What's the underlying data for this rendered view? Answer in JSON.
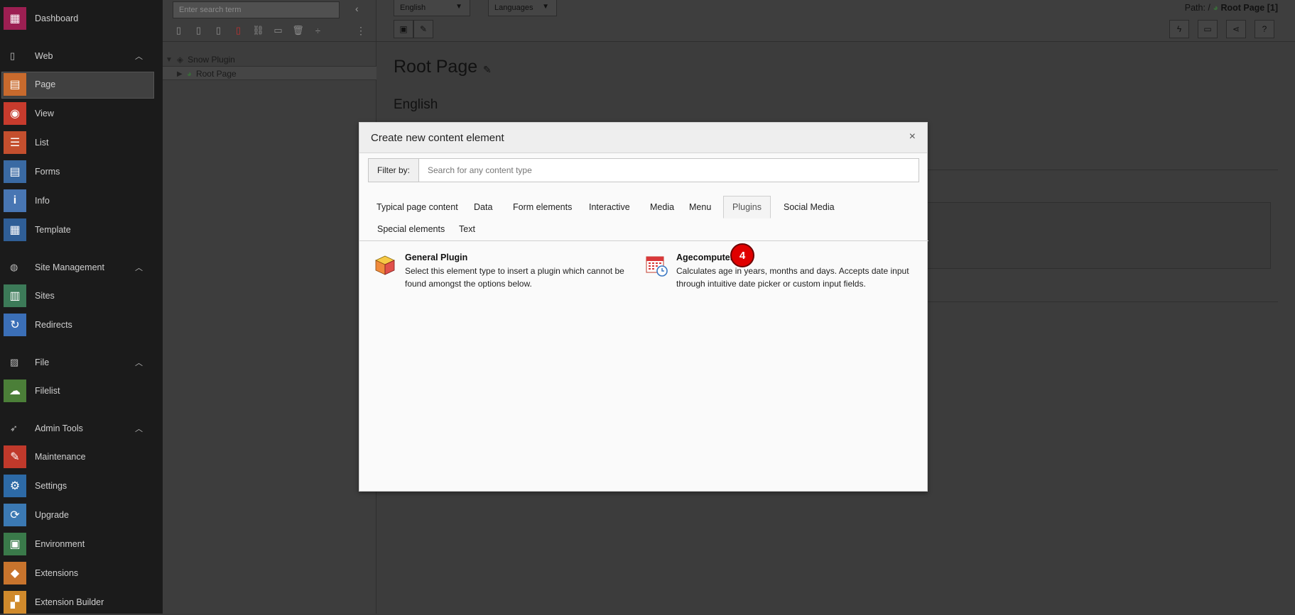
{
  "sidebar": {
    "items": [
      {
        "label": "Dashboard",
        "icon": "dashboard-icon",
        "color": "#9c1f52",
        "glyph": "▦"
      },
      {
        "label": "Page",
        "icon": "page-icon",
        "color": "#c86a2d",
        "glyph": "▤"
      },
      {
        "label": "View",
        "icon": "view-icon",
        "color": "#c73b2d",
        "glyph": "◉"
      },
      {
        "label": "List",
        "icon": "list-icon",
        "color": "#c44f2e",
        "glyph": "☰"
      },
      {
        "label": "Forms",
        "icon": "forms-icon",
        "color": "#3a6aa3",
        "glyph": "▤"
      },
      {
        "label": "Info",
        "icon": "info-icon",
        "color": "#4876b3",
        "glyph": "i"
      },
      {
        "label": "Template",
        "icon": "template-icon",
        "color": "#2f5e96",
        "glyph": "▦"
      },
      {
        "label": "Sites",
        "icon": "sites-icon",
        "color": "#3c7a58",
        "glyph": "▥"
      },
      {
        "label": "Redirects",
        "icon": "redirects-icon",
        "color": "#3b6fb7",
        "glyph": "↻"
      },
      {
        "label": "Filelist",
        "icon": "filelist-icon",
        "color": "#4b7f38",
        "glyph": "☁"
      },
      {
        "label": "Maintenance",
        "icon": "maintenance-icon",
        "color": "#c0392b",
        "glyph": "✎"
      },
      {
        "label": "Settings",
        "icon": "settings-icon",
        "color": "#2d6aa6",
        "glyph": "⚙"
      },
      {
        "label": "Upgrade",
        "icon": "upgrade-icon",
        "color": "#3b79b3",
        "glyph": "⟳"
      },
      {
        "label": "Environment",
        "icon": "environment-icon",
        "color": "#3a7a4a",
        "glyph": "▣"
      },
      {
        "label": "Extensions",
        "icon": "extensions-icon",
        "color": "#c8742d",
        "glyph": "◆"
      },
      {
        "label": "Extension Builder",
        "icon": "extension-builder-icon",
        "color": "#d08a2c",
        "glyph": "▞"
      }
    ],
    "groups": [
      {
        "label": "Web",
        "icon": "web-icon",
        "glyph": "▯"
      },
      {
        "label": "Site Management",
        "icon": "site-management-icon",
        "glyph": "◍"
      },
      {
        "label": "File",
        "icon": "file-icon",
        "glyph": "▨"
      },
      {
        "label": "Admin Tools",
        "icon": "admin-tools-icon",
        "glyph": "➶"
      }
    ]
  },
  "tree": {
    "search_placeholder": "Enter search term",
    "nodes": [
      {
        "label": "Snow Plugin"
      },
      {
        "label": "Root Page"
      }
    ]
  },
  "toolbar": {
    "language_select": "English",
    "languages_select": "Languages",
    "path_prefix": "Path: /",
    "path_current": "Root Page [1]"
  },
  "page": {
    "title": "Root Page",
    "language_heading": "English"
  },
  "modal": {
    "title": "Create new content element",
    "close": "×",
    "filter_label": "Filter by:",
    "filter_placeholder": "Search for any content type",
    "tabs": [
      "Typical page content",
      "Data",
      "Form elements",
      "Interactive",
      "Media",
      "Menu",
      "Plugins",
      "Social Media",
      "Special elements",
      "Text"
    ],
    "active_tab": "Plugins",
    "items": [
      {
        "title": "General Plugin",
        "description": "Select this element type to insert a plugin which cannot be found amongst the options below.",
        "icon": "plugin-cube-icon"
      },
      {
        "title": "Agecomputer",
        "description": "Calculates age in years, months and days. Accepts date input through intuitive date picker or custom input fields.",
        "icon": "calendar-clock-icon"
      }
    ]
  },
  "annotation": {
    "badge": "4"
  },
  "colors": {
    "accent": "#e00000"
  }
}
